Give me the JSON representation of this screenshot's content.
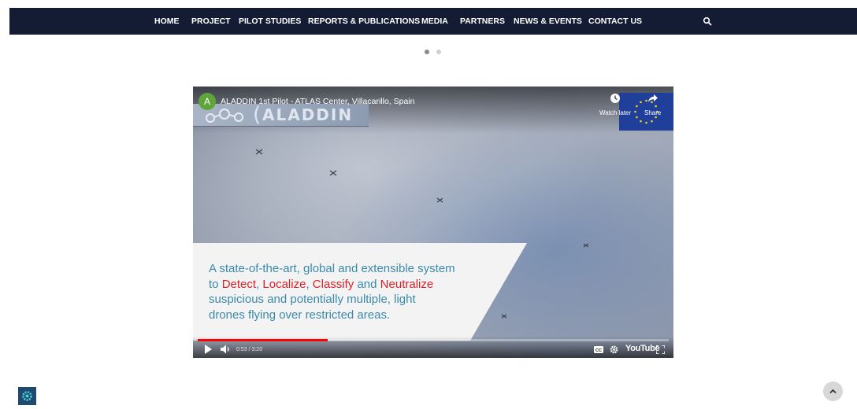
{
  "nav": {
    "items": [
      "HOME",
      "PROJECT",
      "PILOT STUDIES",
      "REPORTS & PUBLICATIONS",
      "MEDIA",
      "PARTNERS",
      "NEWS & EVENTS",
      "CONTACT US"
    ],
    "search_icon": "search-icon",
    "background": "#141c33"
  },
  "slider": {
    "dots": 2,
    "active_index": 0
  },
  "video": {
    "channel_initial": "A",
    "title": "ALADDIN 1st Pilot - ATLAS Center, Villacarillo, Spain",
    "logo_text": "ALADDIN",
    "watch_later_label": "Watch later",
    "share_label": "Share",
    "caption": {
      "line1": "A state-of-the-art, global and extensible system",
      "line2_prefix": "to ",
      "detect": "Detect",
      "sep1": ", ",
      "localize": "Localize",
      "sep2": ", ",
      "classify": "Classify",
      "and": " and ",
      "neutralize": "Neutralize",
      "line3": "suspicious and potentially multiple, light",
      "line4": "drones flying over restricted areas."
    },
    "time_display": "0:53 / 3:20",
    "progress_fraction": 0.276,
    "youtube_label": "YouTube",
    "accent_red": "#d8222a",
    "caption_blue": "#3a8aa9"
  },
  "corner": {
    "cookie_icon": "gear-icon",
    "scroll_top_icon": "chevron-up-icon"
  }
}
